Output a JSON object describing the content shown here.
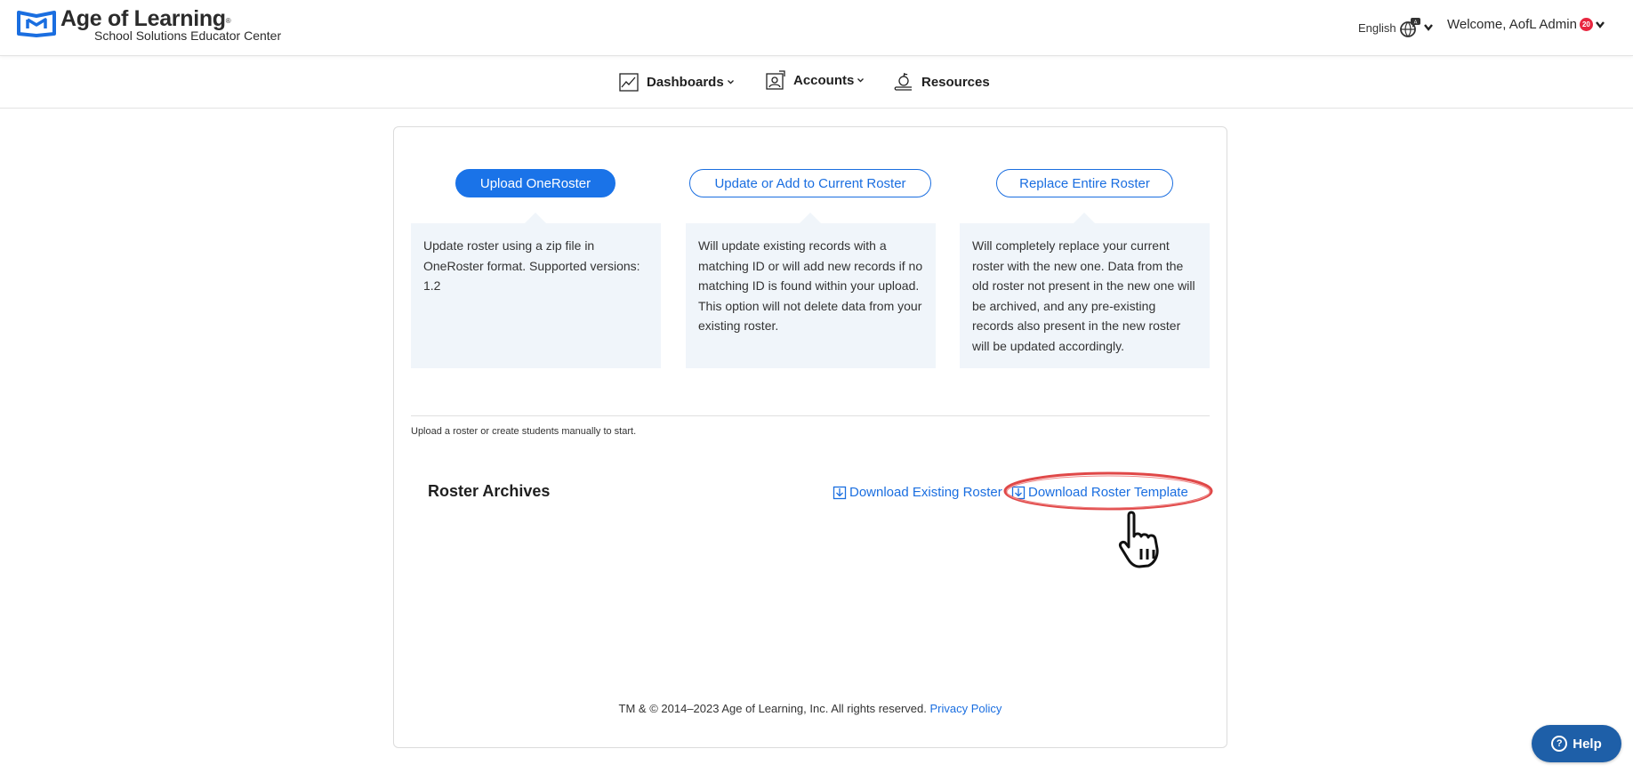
{
  "header": {
    "brand_title": "Age of Learning",
    "brand_reg": "®",
    "brand_subtitle": "School Solutions Educator Center",
    "language": "English",
    "welcome": "Welcome, AofL Admin",
    "badge": "20"
  },
  "nav": {
    "dashboards": "Dashboards",
    "accounts": "Accounts",
    "resources": "Resources"
  },
  "options": [
    {
      "label": "Upload OneRoster",
      "description": "Update roster using a zip file in OneRoster format. Supported versions: 1.2"
    },
    {
      "label": "Update or Add to Current Roster",
      "description": "Will update existing records with a matching ID or will add new records if no matching ID is found within your upload. This option will not delete data from your existing roster."
    },
    {
      "label": "Replace Entire Roster",
      "description": "Will completely replace your current roster with the new one. Data from the old roster not present in the new one will be archived, and any pre-existing records also present in the new roster will be updated accordingly."
    }
  ],
  "hint": "Upload a roster or create students manually to start.",
  "archives": {
    "title": "Roster Archives",
    "download_existing": "Download Existing Roster",
    "download_template": "Download Roster Template"
  },
  "footer": {
    "copyright": "TM & © 2014–2023 Age of Learning, Inc. All rights reserved.",
    "privacy": "Privacy Policy"
  },
  "help": {
    "label": "Help"
  },
  "colors": {
    "primary": "#1a73e8",
    "link": "#1a6ee0",
    "box_bg": "#f0f5fa",
    "highlight_ring": "#e04848",
    "help_bg": "#1e5fa8",
    "badge": "#e8263f"
  }
}
